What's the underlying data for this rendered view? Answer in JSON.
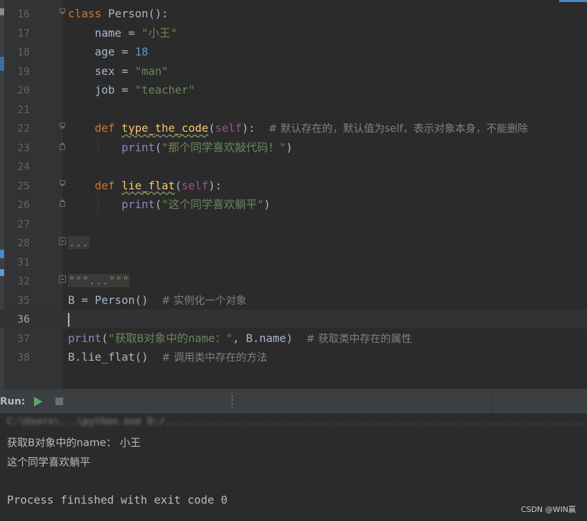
{
  "editor": {
    "lines": [
      {
        "n": "16",
        "tokens": [
          {
            "c": "kw",
            "t": "class"
          },
          {
            "c": "cls",
            "t": " Person():"
          }
        ]
      },
      {
        "n": "17",
        "tokens": [
          {
            "c": "",
            "t": "    name = "
          },
          {
            "c": "str",
            "t": "\"小王\""
          }
        ]
      },
      {
        "n": "18",
        "tokens": [
          {
            "c": "",
            "t": "    age = "
          },
          {
            "c": "num",
            "t": "18"
          }
        ]
      },
      {
        "n": "19",
        "tokens": [
          {
            "c": "",
            "t": "    sex = "
          },
          {
            "c": "str",
            "t": "\"man\""
          }
        ]
      },
      {
        "n": "20",
        "tokens": [
          {
            "c": "",
            "t": "    job = "
          },
          {
            "c": "str",
            "t": "\"teacher\""
          }
        ]
      },
      {
        "n": "21",
        "tokens": []
      },
      {
        "n": "22",
        "tokens": [
          {
            "c": "",
            "t": "    "
          },
          {
            "c": "kw",
            "t": "def"
          },
          {
            "c": "",
            "t": " "
          },
          {
            "c": "fn",
            "t": "type_the_code"
          },
          {
            "c": "",
            "t": "("
          },
          {
            "c": "self",
            "t": "self"
          },
          {
            "c": "",
            "t": "):  "
          },
          {
            "c": "cmt",
            "t": "# 默认存在的，默认值为self，表示对象本身，不能删除"
          }
        ]
      },
      {
        "n": "23",
        "tokens": [
          {
            "c": "",
            "t": "        "
          },
          {
            "c": "builtin",
            "t": "print"
          },
          {
            "c": "",
            "t": "("
          },
          {
            "c": "str",
            "t": "\"那个同学喜欢敲代码！\""
          },
          {
            "c": "",
            "t": ")"
          }
        ]
      },
      {
        "n": "24",
        "tokens": []
      },
      {
        "n": "25",
        "tokens": [
          {
            "c": "",
            "t": "    "
          },
          {
            "c": "kw",
            "t": "def"
          },
          {
            "c": "",
            "t": " "
          },
          {
            "c": "fn",
            "t": "lie_flat"
          },
          {
            "c": "",
            "t": "("
          },
          {
            "c": "self",
            "t": "self"
          },
          {
            "c": "",
            "t": "):"
          }
        ]
      },
      {
        "n": "26",
        "tokens": [
          {
            "c": "",
            "t": "        "
          },
          {
            "c": "builtin",
            "t": "print"
          },
          {
            "c": "",
            "t": "("
          },
          {
            "c": "str",
            "t": "\"这个同学喜欢躺平\""
          },
          {
            "c": "",
            "t": ")"
          }
        ]
      },
      {
        "n": "27",
        "tokens": []
      },
      {
        "n": "28",
        "tokens": [
          {
            "c": "fold-text",
            "t": "..."
          }
        ]
      },
      {
        "n": "31",
        "tokens": []
      },
      {
        "n": "32",
        "tokens": [
          {
            "c": "docfold",
            "t": "\"\"\"...\"\"\""
          }
        ]
      },
      {
        "n": "35",
        "tokens": [
          {
            "c": "",
            "t": "B = Person()  "
          },
          {
            "c": "cmt",
            "t": "# 实例化一个对象"
          }
        ]
      },
      {
        "n": "36",
        "tokens": [],
        "current": true
      },
      {
        "n": "37",
        "tokens": [
          {
            "c": "builtin",
            "t": "print"
          },
          {
            "c": "",
            "t": "("
          },
          {
            "c": "str",
            "t": "\"获取B对象中的name：\""
          },
          {
            "c": "",
            "t": ", B.name)  "
          },
          {
            "c": "cmt",
            "t": "# 获取类中存在的属性"
          }
        ]
      },
      {
        "n": "38",
        "tokens": [
          {
            "c": "",
            "t": "B.lie_flat()  "
          },
          {
            "c": "cmt",
            "t": "# 调用类中存在的方法"
          }
        ]
      }
    ],
    "folds": {
      "16": "arrow",
      "22": "arrow",
      "23": "end",
      "25": "arrow",
      "26": "end",
      "28": "box",
      "32": "box"
    }
  },
  "run": {
    "label": "Run:",
    "play_icon": "play-icon",
    "stop_icon": "stop-icon"
  },
  "console": {
    "pathline": "C:\\Users\\...\\python.exe D:/...........................................................................................py",
    "output_1": "获取B对象中的name： 小王",
    "output_2": "这个同学喜欢躺平",
    "output_3": "",
    "exit_message": "Process finished with exit code 0"
  },
  "watermark": "CSDN @WIN赢"
}
